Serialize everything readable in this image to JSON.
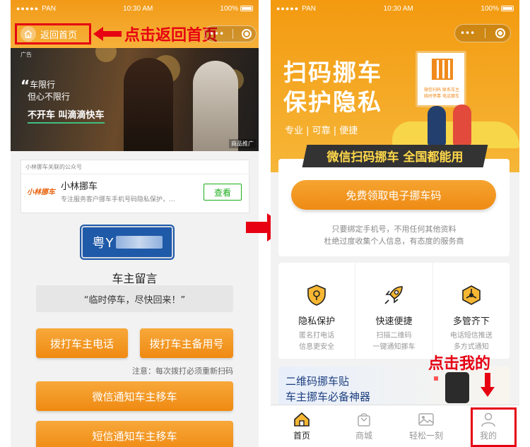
{
  "status": {
    "carrier": "PAN",
    "time": "10:30 AM",
    "battery": "100%"
  },
  "left": {
    "home_label": "返回首页",
    "annotation": "点击返回首页",
    "ad": {
      "tag": "广告",
      "quote_line1": "车限行",
      "quote_line2": "但心不限行",
      "slogan": "不开车 叫滴滴快车",
      "product_tag": "商品推广"
    },
    "official": {
      "header": "小林挪车关联的公众号",
      "logo_text": "小林挪车",
      "name": "小林挪车",
      "desc": "专注服务客户挪车手机号码隐私保护，…",
      "view_label": "查看"
    },
    "plate_prefix": "粤Y",
    "owner_title": "车主留言",
    "message": "“临时停车，尽快回来！”",
    "call_owner": "拨打车主电话",
    "call_backup": "拨打车主备用号",
    "note": "注意：每次拨打必须重新扫码",
    "wechat_notify": "微信通知车主移车",
    "sms_notify": "短信通知车主移车"
  },
  "right": {
    "hero_title_1": "扫码挪车",
    "hero_title_2": "保护隐私",
    "hero_sub": "专业 | 可靠 | 便捷",
    "poster_text_1": "微信扫码 联系车主",
    "poster_text_2": "临时停靠 电话挪车",
    "hero_banner": "微信扫码挪车 全国都能用",
    "free_button": "免费领取电子挪车码",
    "desc1": "只要绑定手机号，不用任何其他资料",
    "desc2": "杜绝过度收集个人信息，有态度的服务商",
    "features": [
      {
        "icon": "shield-lock-icon",
        "title": "隐私保护",
        "d1": "匿名打电话",
        "d2": "信息更安全"
      },
      {
        "icon": "rocket-icon",
        "title": "快速便捷",
        "d1": "扫描二维码",
        "d2": "一键通知挪车"
      },
      {
        "icon": "network-cube-icon",
        "title": "多管齐下",
        "d1": "电话短信推送",
        "d2": "多方式通知"
      }
    ],
    "promo_line1": "二维码挪车贴",
    "promo_line2": "车主挪车必备神器",
    "annotation": "点击我的",
    "tabs": [
      {
        "label": "首页",
        "icon": "home-icon"
      },
      {
        "label": "商城",
        "icon": "shopping-bag-icon"
      },
      {
        "label": "轻松一刻",
        "icon": "picture-icon"
      },
      {
        "label": "我的",
        "icon": "user-icon"
      }
    ]
  },
  "colors": {
    "orange": "#f39a10",
    "annotation_red": "#e60012",
    "wechat_green": "#1aad19",
    "plate_blue": "#1f5aa8"
  }
}
